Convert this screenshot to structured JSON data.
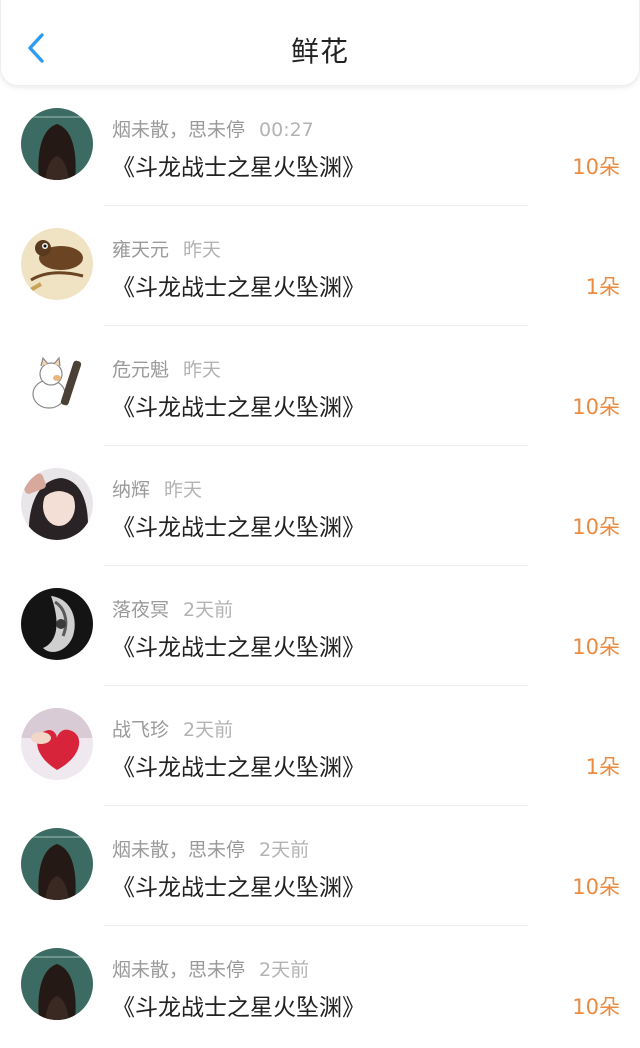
{
  "header": {
    "title": "鲜花",
    "back_icon": "chevron-left-icon",
    "accent_color": "#2e9bf0"
  },
  "colors": {
    "amount": "#ec8a3f",
    "name": "#9a9a9a",
    "book": "#222222"
  },
  "list": [
    {
      "name": "烟未散，思未停",
      "time": "00:27",
      "book": "《斗龙战士之星火坠渊》",
      "amount": "10朵",
      "avatar": "avatar-girl-long-hair"
    },
    {
      "name": "雍天元",
      "time": "昨天",
      "book": "《斗龙战士之星火坠渊》",
      "amount": "1朵",
      "avatar": "avatar-mouse-art"
    },
    {
      "name": "危元魁",
      "time": "昨天",
      "book": "《斗龙战士之星火坠渊》",
      "amount": "10朵",
      "avatar": "avatar-cat-bottle"
    },
    {
      "name": "纳辉",
      "time": "昨天",
      "book": "《斗龙战士之星火坠渊》",
      "amount": "10朵",
      "avatar": "avatar-girl-photo"
    },
    {
      "name": "落夜冥",
      "time": "2天前",
      "book": "《斗龙战士之星火坠渊》",
      "amount": "10朵",
      "avatar": "avatar-dark-monochrome"
    },
    {
      "name": "战飞珍",
      "time": "2天前",
      "book": "《斗龙战士之星火坠渊》",
      "amount": "1朵",
      "avatar": "avatar-red-heart"
    },
    {
      "name": "烟未散，思未停",
      "time": "2天前",
      "book": "《斗龙战士之星火坠渊》",
      "amount": "10朵",
      "avatar": "avatar-girl-long-hair"
    },
    {
      "name": "烟未散，思未停",
      "time": "2天前",
      "book": "《斗龙战士之星火坠渊》",
      "amount": "10朵",
      "avatar": "avatar-girl-long-hair"
    }
  ]
}
